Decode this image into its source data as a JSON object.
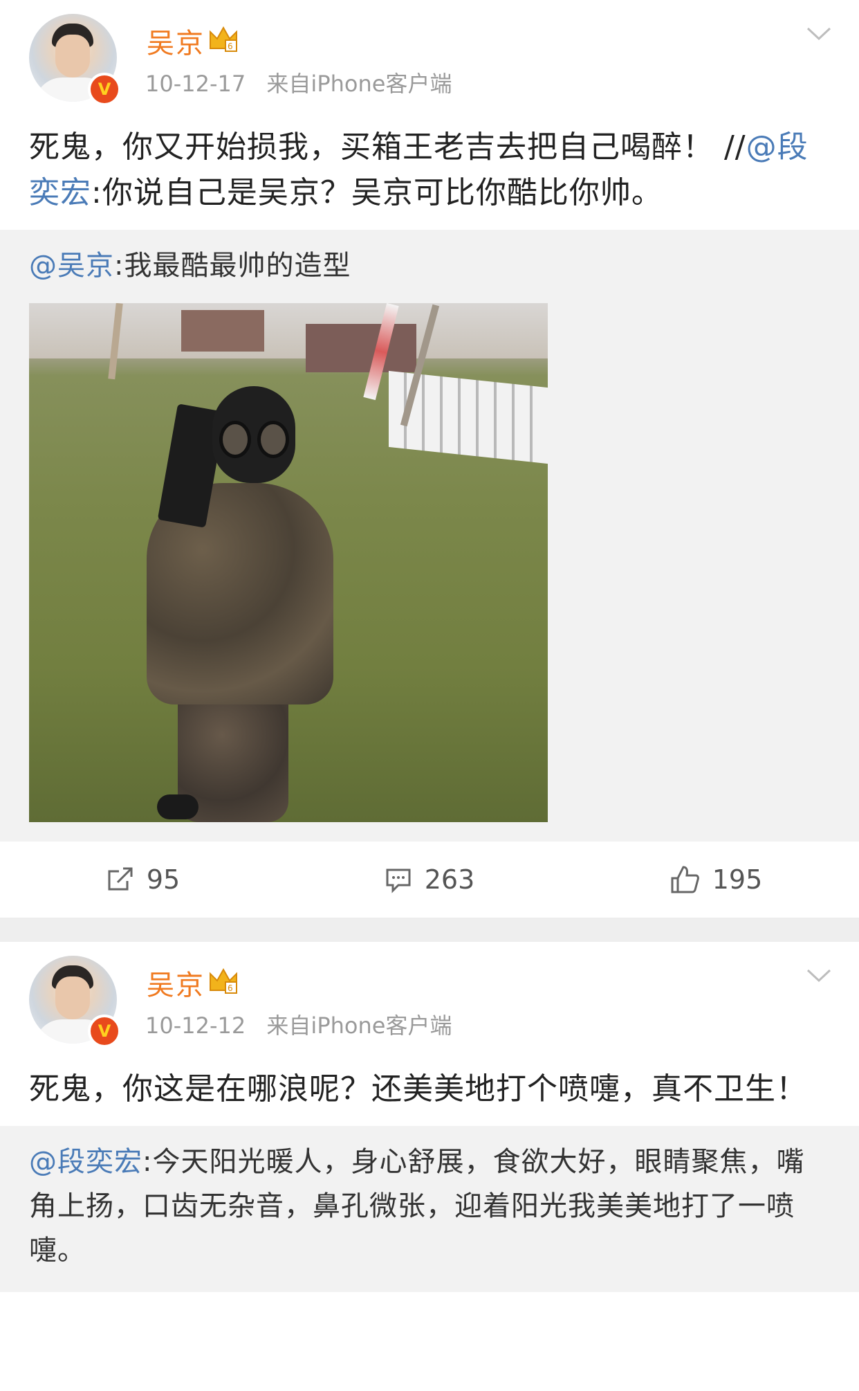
{
  "posts": [
    {
      "username": "吴京",
      "time": "10-12-17",
      "source": "来自iPhone客户端",
      "verified_badge": "V",
      "content_text": "死鬼，你又开始损我，买箱王老吉去把自己喝醉！ //",
      "content_mention": "@段奕宏",
      "content_after": ":你说自己是吴京？吴京可比你酷比你帅。",
      "repost_mention": "@吴京",
      "repost_text": ":我最酷最帅的造型",
      "actions": {
        "repost": "95",
        "comment": "263",
        "like": "195"
      }
    },
    {
      "username": "吴京",
      "time": "10-12-12",
      "source": "来自iPhone客户端",
      "verified_badge": "V",
      "content_text": "死鬼，你这是在哪浪呢？还美美地打个喷嚏，真不卫生！",
      "repost_mention": "@段奕宏",
      "repost_text": ":今天阳光暖人，身心舒展，食欲大好，眼睛聚焦，嘴角上扬，口齿无杂音，鼻孔微张，迎着阳光我美美地打了一喷嚏。"
    }
  ],
  "colors": {
    "username": "#f07a20",
    "mention": "#4a7bb7",
    "meta": "#9a9a9a",
    "repost_bg": "#f2f2f2"
  },
  "icons": [
    "crown-vip-icon",
    "chevron-down-icon",
    "repost-icon",
    "comment-icon",
    "like-icon"
  ]
}
